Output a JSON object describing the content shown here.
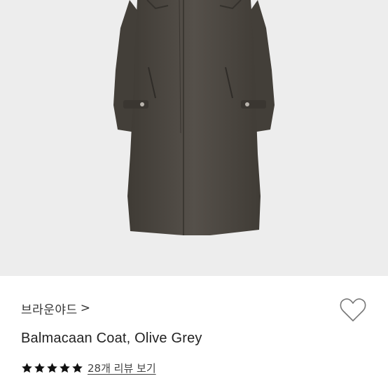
{
  "product": {
    "brand": "브라운야드",
    "brand_chevron": ">",
    "title": "Balmacaan Coat, Olive Grey",
    "rating": 5,
    "rating_max": 5,
    "review_link": "28개 리뷰 보기"
  },
  "icons": {
    "wishlist": "heart-icon",
    "star": "star-icon",
    "brand_arrow": "chevron-right-icon"
  },
  "colors": {
    "image_bg": "#ededed",
    "coat": "#4c4740",
    "text": "#222222",
    "star": "#111111"
  }
}
